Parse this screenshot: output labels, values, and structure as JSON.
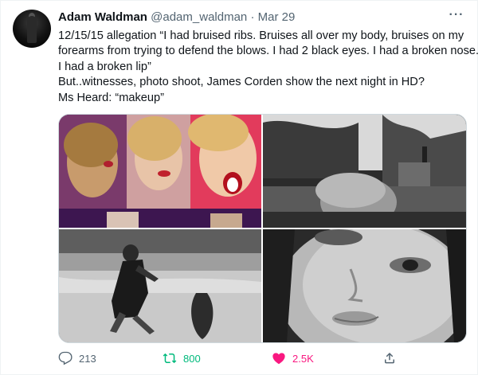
{
  "tweet": {
    "author_name": "Adam Waldman",
    "handle": "@adam_waldman",
    "separator": "·",
    "date": "Mar 29",
    "more_label": "···",
    "lines": [
      "12/15/15 allegation “I had bruised ribs. Bruises all over my body, bruises on my",
      "forearms from trying to defend the blows. I had 2 black eyes. I had a broken nose.",
      "I had a broken lip”",
      "But..witnesses, photo shoot, James Corden show the next night in HD?",
      "Ms Heard: “makeup”"
    ]
  },
  "media": {
    "images": [
      {
        "name": "photo-collage-talk-show-color"
      },
      {
        "name": "photo-bw-beach-palms"
      },
      {
        "name": "photo-bw-running-beach"
      },
      {
        "name": "photo-bw-face-closeup"
      }
    ]
  },
  "actions": {
    "reply": {
      "icon": "reply-icon",
      "count": "213"
    },
    "retweet": {
      "icon": "retweet-icon",
      "count": "800",
      "color": "#00ba7c"
    },
    "like": {
      "icon": "heart-icon",
      "count": "2.5K",
      "color": "#f91880"
    },
    "share": {
      "icon": "share-icon"
    }
  }
}
